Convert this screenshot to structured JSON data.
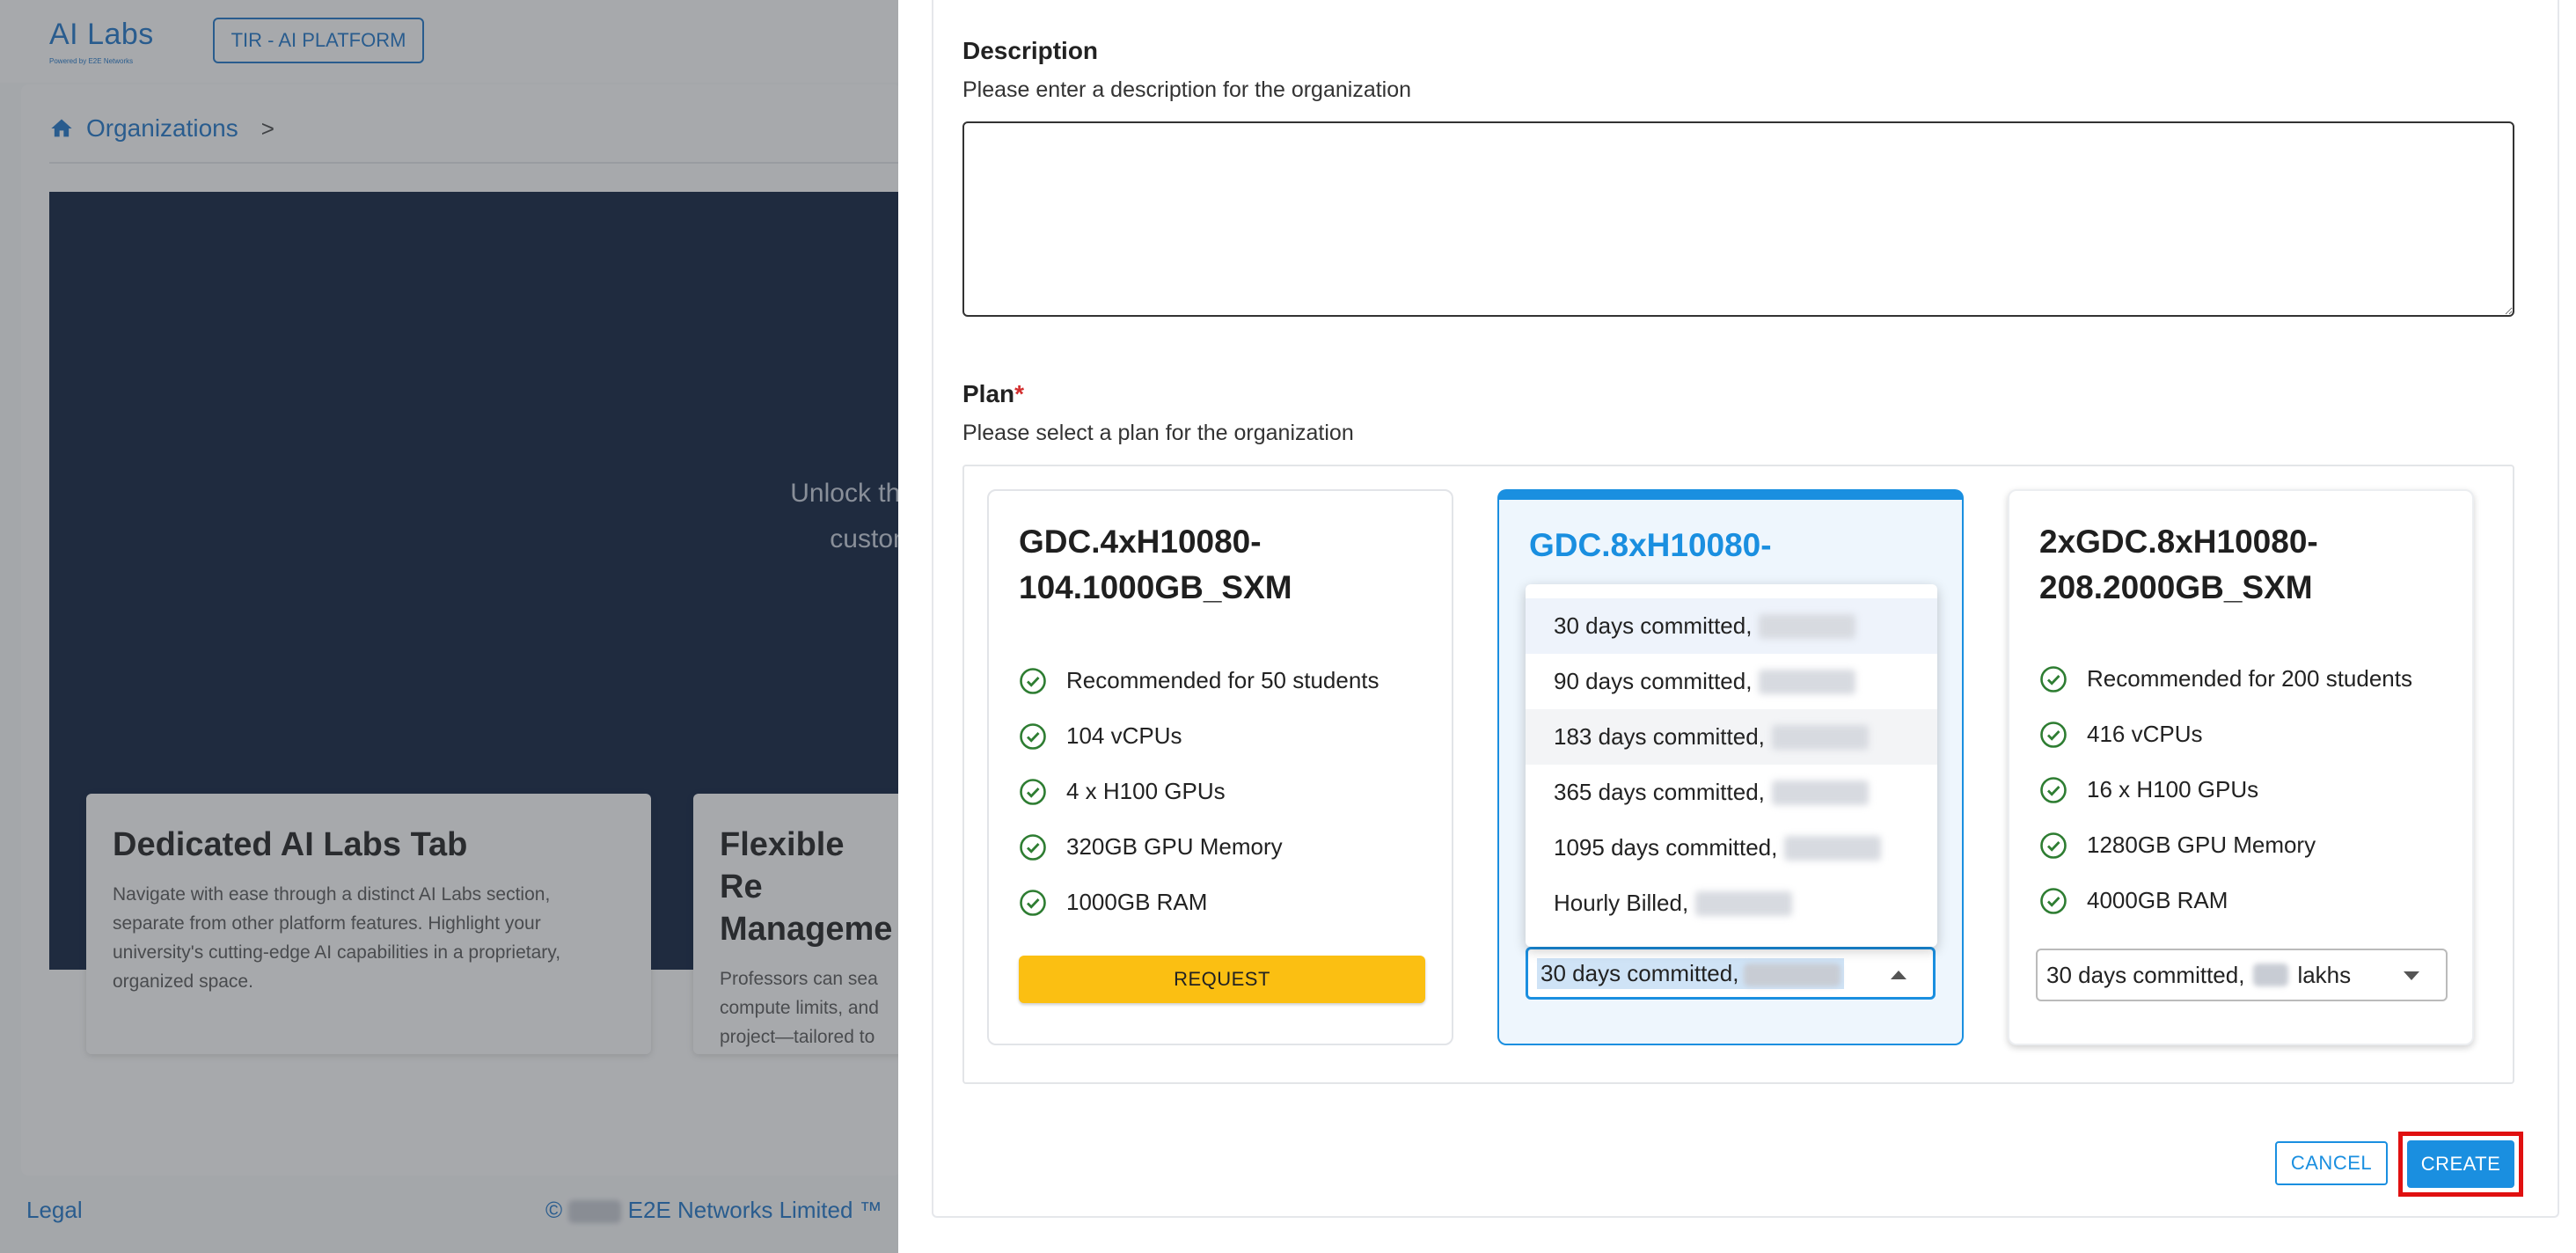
{
  "header": {
    "logo_text": "AI Labs",
    "logo_sub": "Powered by E2E Networks",
    "platform_label": "TIR - AI PLATFORM"
  },
  "breadcrumb": {
    "home": "Organizations",
    "separator": ">"
  },
  "hero": {
    "text": "Unlock the custom"
  },
  "feature_cards": [
    {
      "title": "Dedicated AI Labs Tab",
      "body": "Navigate with ease through a distinct AI Labs section, separate from other platform features. Highlight your university's cutting-edge AI capabilities in a proprietary, organized space."
    },
    {
      "title": "Flexible Re Manageme",
      "body": "Professors can sea compute limits, and project—tailored to"
    }
  ],
  "footer": {
    "legal": "Legal",
    "copyright_prefix": "©",
    "copyright": "E2E Networks Limited ™"
  },
  "form": {
    "description": {
      "title": "Description",
      "subtitle": "Please enter a description for the organization",
      "value": ""
    },
    "plan": {
      "title": "Plan",
      "required_mark": "*",
      "subtitle": "Please select a plan for the organization"
    }
  },
  "plans": [
    {
      "name": "GDC.4xH10080-104.1000GB_SXM",
      "features": [
        "Recommended for 50 students",
        "104 vCPUs",
        "4 x H100 GPUs",
        "320GB GPU Memory",
        "1000GB RAM"
      ],
      "action_label": "REQUEST"
    },
    {
      "name": "GDC.8xH10080-",
      "selected": true,
      "select_value": "30 days committed,",
      "dropdown_options": [
        "30 days committed,",
        "90 days committed,",
        "183 days committed,",
        "365 days committed,",
        "1095 days committed,",
        "Hourly Billed,"
      ]
    },
    {
      "name": "2xGDC.8xH10080-208.2000GB_SXM",
      "features": [
        "Recommended for 200 students",
        "416 vCPUs",
        "16 x H100 GPUs",
        "1280GB GPU Memory",
        "4000GB RAM"
      ],
      "select_value": "30 days committed,",
      "select_suffix": "lakhs"
    }
  ],
  "actions": {
    "cancel": "CANCEL",
    "create": "CREATE"
  },
  "colors": {
    "primary": "#1a8fe0",
    "request": "#fbbf12",
    "check": "#2e7d32",
    "highlight_outline": "#e01010",
    "hero_bg": "#081a3a"
  }
}
